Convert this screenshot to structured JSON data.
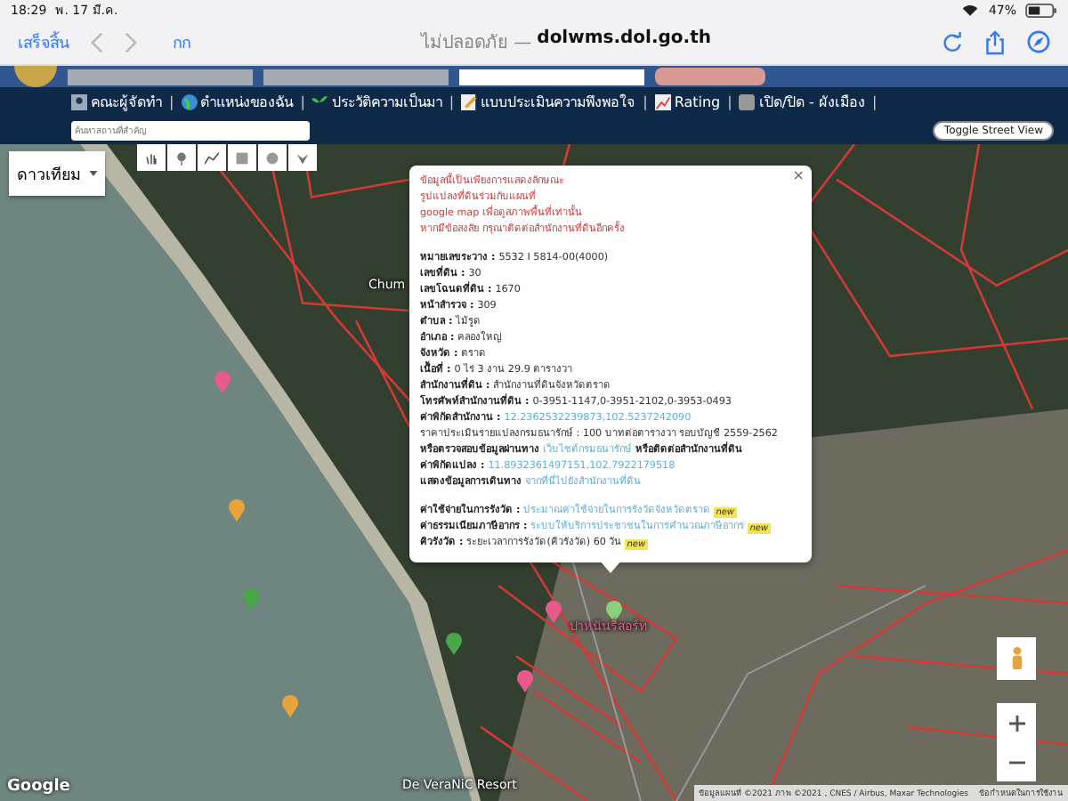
{
  "status_bar": {
    "time": "18:29",
    "date": "พ. 17 มี.ค.",
    "battery": "47%"
  },
  "browser": {
    "done": "เสร็จสิ้น",
    "text_size": "กก",
    "security": "ไม่ปลอดภัย —",
    "domain": "dolwms.dol.go.th"
  },
  "menu": {
    "items": [
      {
        "label": "คณะผู้จัดทำ",
        "kind": "team",
        "separator": "|"
      },
      {
        "label": "ตำแหน่งของฉัน",
        "kind": "globe",
        "separator": "|"
      },
      {
        "label": "ประวัติความเป็นมา",
        "kind": "sprout",
        "separator": "|"
      },
      {
        "label": "แบบประเมินความพึงพอใจ",
        "kind": "form",
        "separator": "|"
      },
      {
        "label": "Rating",
        "kind": "chart",
        "separator": "|"
      },
      {
        "label": "เปิด/ปิด - ผังเมือง",
        "kind": "toggle",
        "separator": "|"
      }
    ],
    "search": {
      "placeholder": "ค้นหาสถานที่สำคัญ"
    },
    "street_view_button": "Toggle Street View"
  },
  "map": {
    "map_type": "ดาวเทียม",
    "places": [
      {
        "label": "Chum",
        "color": "#ffffff"
      },
      {
        "label": "ปาหนันรีสอร์ท",
        "color": "#e85a8c"
      },
      {
        "label": "De VeraNiC Resort",
        "color": "#ffffff"
      }
    ],
    "attribution": "ข้อมูลแผนที่ ©2021 ภาพ ©2021 , CNES / Airbus, Maxar Technologies",
    "terms": "ข้อกำหนดในการใช้งาน",
    "logo": "Google"
  },
  "popup": {
    "close": "×",
    "notes": [
      "ข้อมูลนี้เป็นเพียงการแสดงลักษณะ",
      "รูปแปลงที่ดินร่วมกับแผนที่",
      "google map เพื่อดูสภาพพื้นที่เท่านั้น",
      "หากมีข้อสงสัย กรุณาติดต่อสำนักงานที่ดินอีกครั้ง"
    ],
    "fields": [
      {
        "label": "หมายเลขระวาง :",
        "value": "5532 I 5814-00(4000)",
        "kind": "text"
      },
      {
        "label": "เลขที่ดิน :",
        "value": "30",
        "kind": "text"
      },
      {
        "label": "เลขโฉนดที่ดิน :",
        "value": "1670",
        "kind": "text"
      },
      {
        "label": "หน้าสำรวจ :",
        "value": "309",
        "kind": "text"
      },
      {
        "label": "ตำบล :",
        "value": "ไม้รูด",
        "kind": "text"
      },
      {
        "label": "อำเภอ :",
        "value": "คลองใหญ่",
        "kind": "text"
      },
      {
        "label": "จังหวัด :",
        "value": "ตราด",
        "kind": "text"
      },
      {
        "label": "เนื้อที่ :",
        "value": "0 ไร่ 3 งาน 29.9 ตารางวา",
        "kind": "text"
      },
      {
        "label": "สำนักงานที่ดิน :",
        "value": "สำนักงานที่ดินจังหวัดตราด",
        "kind": "text"
      },
      {
        "label": "โทรศัพท์สำนักงานที่ดิน :",
        "value": "0-3951-1147,0-3951-2102,0-3953-0493",
        "kind": "text"
      },
      {
        "label": "ค่าพิกัดสำนักงาน :",
        "value": "12.2362532239873,102.5237242090",
        "kind": "link"
      }
    ],
    "price": "ราคาประเมินรายแปลงกรมธนารักษ์ : 100 บาทต่อตารางวา รอบบัญชี 2559-2562",
    "check": {
      "before": "หรือตรวจสอบข้อมูลผ่านทาง",
      "link": "เว็บไซต์กรมธนารักษ์",
      "after": "หรือติดต่อสำนักงานที่ดิน"
    },
    "coords": {
      "label": "ค่าพิกัดแปลง :",
      "value": "11.8932361497151,102.7922179518"
    },
    "route": {
      "label": "แสดงข้อมูลการเดินทาง",
      "link": "จากที่นี่ไปยังสำนักงานที่ดิน"
    },
    "extra": [
      {
        "label": "ค่าใช้จ่ายในการรังวัด :",
        "value": "ประมาณค่าใช้จ่ายในการรังวัดจังหวัดตราด",
        "kind": "link",
        "badge": "new"
      },
      {
        "label": "ค่าธรรมเนียมภาษีอากร :",
        "value": "ระบบให้บริการประชาชนในการคำนวณภาษีอากร",
        "kind": "link",
        "badge": "new"
      },
      {
        "label": "คิวรังวัด :",
        "value": "ระยะเวลาการรังวัด(คิวรังวัด) 60 วัน",
        "kind": "text",
        "badge": "new"
      }
    ]
  }
}
